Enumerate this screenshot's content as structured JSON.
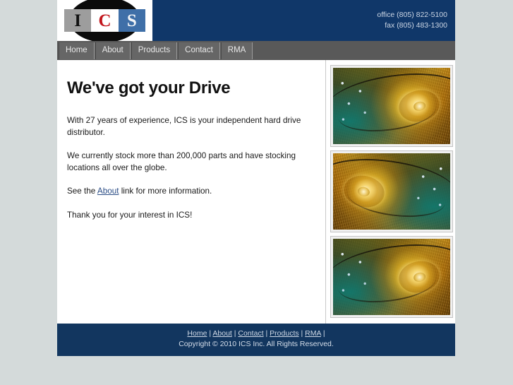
{
  "header": {
    "logo": {
      "letter_1": "I",
      "letter_2": "C",
      "letter_3": "S"
    },
    "office_phone": "office (805) 822-5100",
    "fax_phone": "fax (805) 483-1300"
  },
  "nav": {
    "items": [
      {
        "label": "Home"
      },
      {
        "label": "About"
      },
      {
        "label": "Products"
      },
      {
        "label": "Contact"
      },
      {
        "label": "RMA"
      }
    ]
  },
  "main": {
    "title": "We've got your Drive",
    "para1": "With 27 years of experience, ICS is your independent hard drive distributor.",
    "para2": "We currently stock more than 200,000 parts and have stocking locations all over the globe.",
    "para3_before": "See the ",
    "para3_link": "About",
    "para3_after": " link for more information.",
    "para4": "Thank you for your interest in ICS!"
  },
  "photos": [
    {
      "alt": "hard-drive-macro-photo-1"
    },
    {
      "alt": "hard-drive-macro-photo-2"
    },
    {
      "alt": "hard-drive-macro-photo-3"
    }
  ],
  "footer": {
    "links": [
      {
        "label": "Home"
      },
      {
        "label": "About"
      },
      {
        "label": "Contact"
      },
      {
        "label": "Products"
      },
      {
        "label": "RMA"
      }
    ],
    "separator": " | ",
    "trailing_separator": " |",
    "copyright": "Copyright © 2010 ICS Inc. All Rights Reserved."
  },
  "colors": {
    "header_blue": "#103769",
    "footer_blue": "#12365f",
    "nav_gray": "#595959",
    "page_bg": "#d4dada",
    "link_blue": "#2b4d86",
    "logo_red": "#c2161d",
    "logo_blue": "#3f6fa8",
    "logo_gray": "#9d9d9d"
  }
}
